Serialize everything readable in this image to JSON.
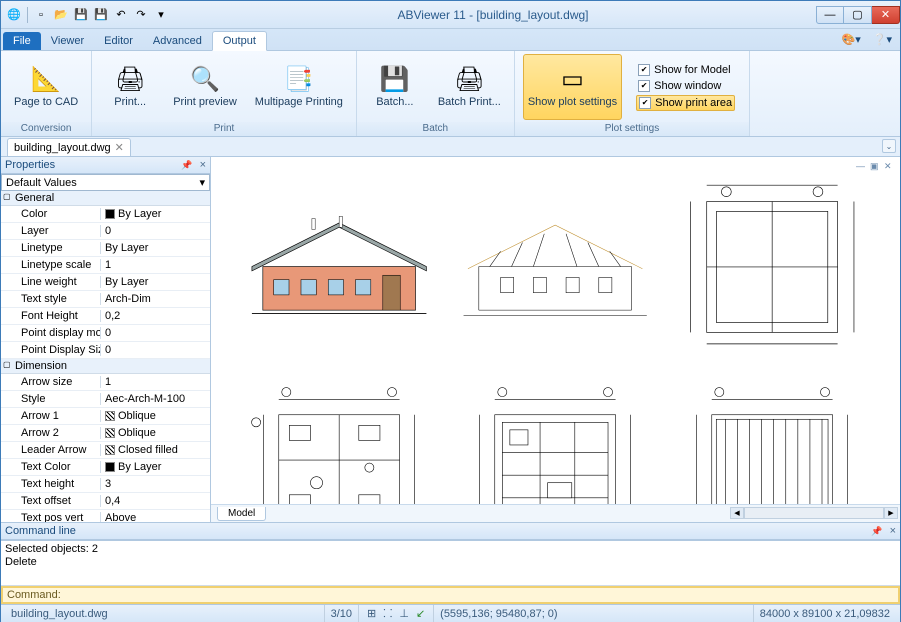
{
  "title": "ABViewer 11 - [building_layout.dwg]",
  "qat_icons": [
    "app-icon",
    "new-icon",
    "open-icon",
    "save-icon",
    "save-as-icon",
    "undo-icon",
    "redo-icon",
    "dropdown-icon"
  ],
  "ribbon": {
    "tabs": [
      "File",
      "Viewer",
      "Editor",
      "Advanced",
      "Output"
    ],
    "active_tab": "Output",
    "groups": [
      {
        "label": "Conversion",
        "buttons": [
          {
            "id": "page-to-cad",
            "label": "Page to CAD",
            "icon": "📐"
          }
        ]
      },
      {
        "label": "Print",
        "buttons": [
          {
            "id": "print",
            "label": "Print...",
            "icon": "🖨"
          },
          {
            "id": "print-preview",
            "label": "Print preview",
            "icon": "🔍"
          },
          {
            "id": "multipage-printing",
            "label": "Multipage Printing",
            "icon": "📑"
          }
        ]
      },
      {
        "label": "Batch",
        "buttons": [
          {
            "id": "batch",
            "label": "Batch...",
            "icon": "💾"
          },
          {
            "id": "batch-print",
            "label": "Batch Print...",
            "icon": "🖨"
          }
        ]
      },
      {
        "label": "Plot settings",
        "buttons": [
          {
            "id": "show-plot-settings",
            "label": "Show plot settings",
            "icon": "▭",
            "highlighted": true
          }
        ],
        "checks": [
          {
            "id": "show-for-model",
            "label": "Show for Model",
            "checked": true
          },
          {
            "id": "show-window",
            "label": "Show window",
            "checked": true
          },
          {
            "id": "show-print-area",
            "label": "Show print area",
            "checked": true,
            "highlighted": true
          }
        ]
      }
    ]
  },
  "doc_tab": {
    "label": "building_layout.dwg"
  },
  "properties": {
    "title": "Properties",
    "dropdown": "Default Values",
    "sections": [
      {
        "name": "General",
        "rows": [
          {
            "k": "Color",
            "v": "By Layer",
            "swatch": true
          },
          {
            "k": "Layer",
            "v": "0"
          },
          {
            "k": "Linetype",
            "v": "By Layer"
          },
          {
            "k": "Linetype scale",
            "v": "1"
          },
          {
            "k": "Line weight",
            "v": "By Layer"
          },
          {
            "k": "Text style",
            "v": "Arch-Dim"
          },
          {
            "k": "Font Height",
            "v": "0,2"
          },
          {
            "k": "Point display mo",
            "v": "0"
          },
          {
            "k": "Point Display Siz",
            "v": "0"
          }
        ]
      },
      {
        "name": "Dimension",
        "rows": [
          {
            "k": "Arrow size",
            "v": "1"
          },
          {
            "k": "Style",
            "v": "Aec-Arch-M-100"
          },
          {
            "k": "Arrow 1",
            "v": "Oblique",
            "hatch": true
          },
          {
            "k": "Arrow 2",
            "v": "Oblique",
            "hatch": true
          },
          {
            "k": "Leader Arrow",
            "v": "Closed filled",
            "hatch": true
          },
          {
            "k": "Text Color",
            "v": "By Layer",
            "swatch": true
          },
          {
            "k": "Text height",
            "v": "3"
          },
          {
            "k": "Text offset",
            "v": "0,4"
          },
          {
            "k": "Text pos vert",
            "v": "Above"
          }
        ]
      }
    ]
  },
  "model_tab": "Model",
  "command_line": {
    "title": "Command line",
    "output": [
      "Selected objects: 2",
      "Delete"
    ],
    "prompt": "Command:"
  },
  "status": {
    "filename": "building_layout.dwg",
    "page": "3/10",
    "coords": "(5595,136; 95480,87; 0)",
    "dims": "84000 x 89100 x 21,09832"
  }
}
